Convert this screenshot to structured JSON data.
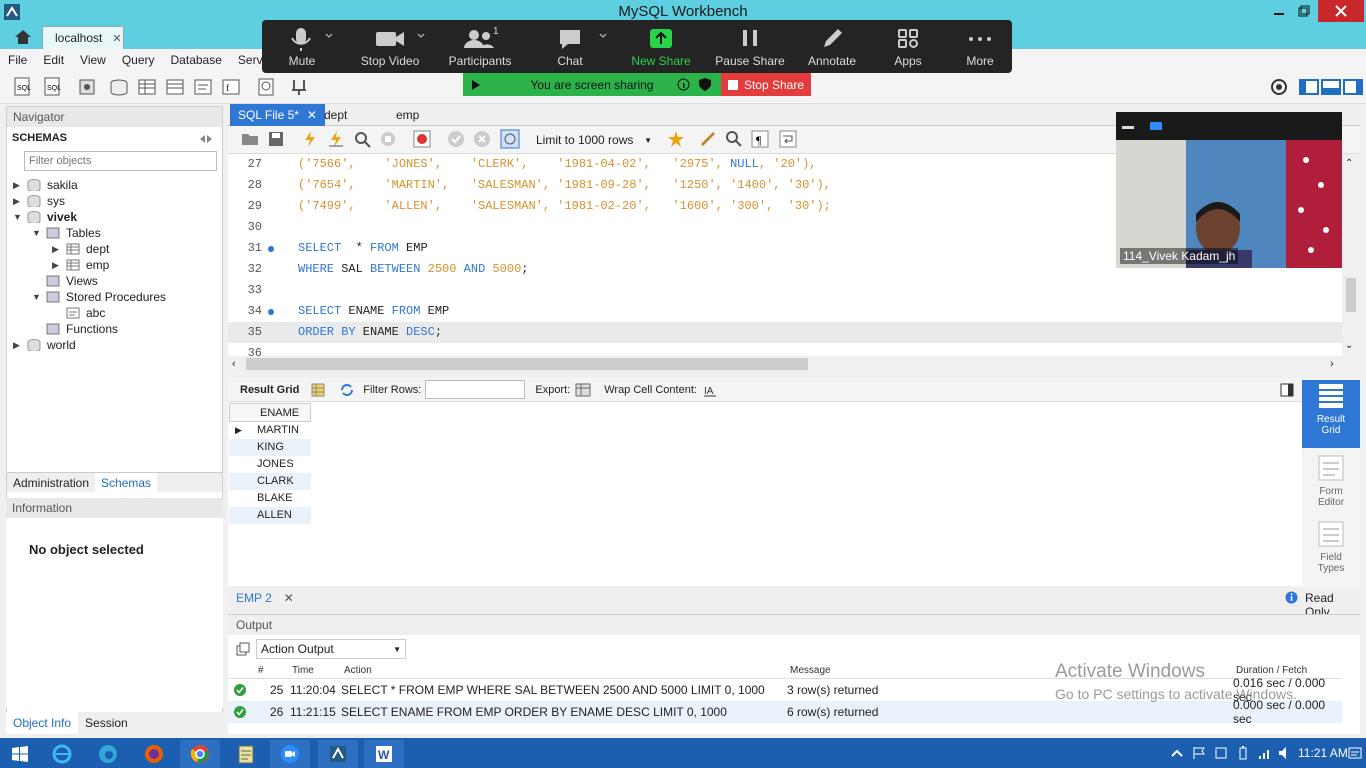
{
  "window": {
    "title": "MySQL Workbench"
  },
  "tabs": {
    "connection": "localhost"
  },
  "menu": [
    "File",
    "Edit",
    "View",
    "Query",
    "Database",
    "Serve"
  ],
  "zoom": {
    "items": [
      {
        "label": "Mute",
        "icon": "microphone-icon"
      },
      {
        "label": "Stop Video",
        "icon": "camera-icon"
      },
      {
        "label": "Participants",
        "icon": "participants-icon",
        "count": "1"
      },
      {
        "label": "Chat",
        "icon": "chat-icon"
      },
      {
        "label": "New Share",
        "icon": "share-icon"
      },
      {
        "label": "Pause Share",
        "icon": "pause-icon"
      },
      {
        "label": "Annotate",
        "icon": "pencil-icon"
      },
      {
        "label": "Apps",
        "icon": "apps-icon"
      },
      {
        "label": "More",
        "icon": "more-icon"
      }
    ],
    "sharing_text": "You are screen sharing",
    "stop_share": "Stop Share",
    "video_name": "114_Vivek Kadam_jh",
    "colors": {
      "bar": "#242424",
      "new_share": "#2bd34a",
      "stop": "#e23c3c"
    }
  },
  "navigator": {
    "title": "Navigator",
    "schemas_label": "SCHEMAS",
    "filter_placeholder": "Filter objects",
    "tree": {
      "sakila": "sakila",
      "sys": "sys",
      "vivek": "vivek",
      "tables": "Tables",
      "dept": "dept",
      "emp": "emp",
      "views": "Views",
      "procedures": "Stored Procedures",
      "abc": "abc",
      "functions": "Functions",
      "world": "world"
    },
    "tab_admin": "Administration",
    "tab_schemas": "Schemas",
    "info_title": "Information",
    "no_object": "No object selected",
    "tab_objinfo": "Object Info",
    "tab_session": "Session"
  },
  "editor": {
    "tabs": [
      "SQL File 5*",
      "dept",
      "emp"
    ],
    "limit": "Limit to 1000 rows",
    "lines": [
      {
        "n": "27",
        "parts": [
          {
            "t": "('7566',    'JONES',    'CLERK',    '1981-04-02',   '2975', ",
            "c": "st"
          },
          {
            "t": "NULL",
            "c": "kw"
          },
          {
            "t": ", '20'),",
            "c": "st"
          }
        ]
      },
      {
        "n": "28",
        "parts": [
          {
            "t": "('7654',    'MARTIN',   'SALESMAN', '1981-09-28',   '1250', '1400', '30'),",
            "c": "st"
          }
        ]
      },
      {
        "n": "29",
        "parts": [
          {
            "t": "('7499',    'ALLEN',    'SALESMAN', '1981-02-20',   '1600', '300',  '30');",
            "c": "st"
          }
        ]
      },
      {
        "n": "30",
        "parts": []
      },
      {
        "n": "31",
        "dot": true,
        "parts": [
          {
            "t": "SELECT",
            "c": "kw"
          },
          {
            "t": "  * ",
            "c": ""
          },
          {
            "t": "FROM",
            "c": "kw"
          },
          {
            "t": " EMP",
            "c": ""
          }
        ]
      },
      {
        "n": "32",
        "parts": [
          {
            "t": "WHERE",
            "c": "kw"
          },
          {
            "t": " SAL ",
            "c": ""
          },
          {
            "t": "BETWEEN",
            "c": "kw"
          },
          {
            "t": " 2500 ",
            "c": "st"
          },
          {
            "t": "AND",
            "c": "kw"
          },
          {
            "t": " 5000",
            "c": "st"
          },
          {
            "t": ";",
            "c": ""
          }
        ]
      },
      {
        "n": "33",
        "parts": []
      },
      {
        "n": "34",
        "dot": true,
        "parts": [
          {
            "t": "SELECT",
            "c": "kw"
          },
          {
            "t": " ENAME ",
            "c": ""
          },
          {
            "t": "FROM",
            "c": "kw"
          },
          {
            "t": " EMP",
            "c": ""
          }
        ]
      },
      {
        "n": "35",
        "hl": true,
        "parts": [
          {
            "t": "ORDER BY",
            "c": "kw"
          },
          {
            "t": " ENAME ",
            "c": ""
          },
          {
            "t": "DESC",
            "c": "kw"
          },
          {
            "t": ";",
            "c": ""
          }
        ]
      },
      {
        "n": "36",
        "parts": []
      }
    ]
  },
  "result": {
    "grid_label": "Result Grid",
    "filter_label": "Filter Rows:",
    "export_label": "Export:",
    "wrap_label": "Wrap Cell Content:",
    "column": "ENAME",
    "rows": [
      "MARTIN",
      "KING",
      "JONES",
      "CLARK",
      "BLAKE",
      "ALLEN"
    ],
    "side": [
      "Result Grid",
      "Form Editor",
      "Field Types"
    ],
    "tab": "EMP 2",
    "readonly": "Read Only"
  },
  "output": {
    "title": "Output",
    "select": "Action Output",
    "headers": [
      "#",
      "Time",
      "Action",
      "Message",
      "Duration / Fetch"
    ],
    "rows": [
      {
        "num": "25",
        "time": "11:20:04",
        "action": "SELECT  * FROM EMP WHERE SAL BETWEEN 2500 AND 5000 LIMIT 0, 1000",
        "msg": "3 row(s) returned",
        "dur": "0.016 sec / 0.000 sec"
      },
      {
        "num": "26",
        "time": "11:21:15",
        "action": "SELECT ENAME FROM EMP ORDER BY ENAME DESC LIMIT 0, 1000",
        "msg": "6 row(s) returned",
        "dur": "0.000 sec / 0.000 sec"
      }
    ]
  },
  "watermark": {
    "l1": "Activate Windows",
    "l2": "Go to PC settings to activate Windows."
  },
  "taskbar": {
    "time": "11:21 AM"
  }
}
